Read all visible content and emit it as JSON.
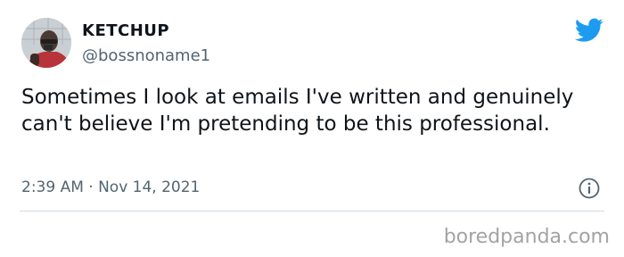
{
  "author": {
    "display_name": "KETCHUP",
    "handle": "@bossnoname1",
    "avatar": "profile-photo"
  },
  "tweet": {
    "text": "Sometimes I look at emails I've written and genuinely can't believe I'm pretending to be this professional.",
    "timestamp": "2:39 AM · Nov 14, 2021"
  },
  "icons": {
    "brand": "twitter-bird-icon",
    "info": "info-icon",
    "brand_color": "#1d9bf0"
  },
  "watermark": "boredpanda.com"
}
